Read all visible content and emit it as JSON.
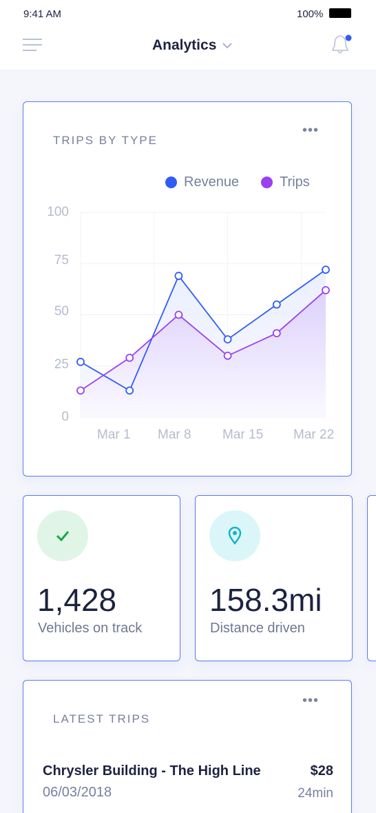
{
  "status": {
    "time": "9:41 AM",
    "battery": "100%"
  },
  "header": {
    "title": "Analytics",
    "menu_icon": "hamburger-icon",
    "bell_icon": "bell-icon",
    "accent": "#2f5cf5"
  },
  "chart_card": {
    "title": "TRIPS BY TYPE",
    "more": "•••"
  },
  "chart_data": {
    "type": "line",
    "title": "TRIPS BY TYPE",
    "x": [
      "",
      "Mar 1",
      "Mar 8",
      "Mar 15",
      "Mar 22",
      ""
    ],
    "xticks": [
      "Mar 1",
      "Mar 8",
      "Mar 15",
      "Mar 22"
    ],
    "yticks": [
      "100",
      "75",
      "50",
      "25",
      "0"
    ],
    "ylim": [
      0,
      100
    ],
    "grid": true,
    "legend": "top-right",
    "series": [
      {
        "name": "Revenue",
        "color": "#2f5cf5",
        "values": [
          27,
          13,
          69,
          38,
          55,
          72
        ]
      },
      {
        "name": "Trips",
        "color": "#9b40f0",
        "values": [
          13,
          29,
          50,
          30,
          41,
          62
        ]
      }
    ]
  },
  "stats": [
    {
      "value": "1,428",
      "label": "Vehicles on track",
      "icon": "check-icon",
      "icon_color": "#19a84a",
      "bg": "#e1f5e6"
    },
    {
      "value": "158.3mi",
      "label": "Distance driven",
      "icon": "map-pin-icon",
      "icon_color": "#12b3c9",
      "bg": "#daf6f8"
    }
  ],
  "latest": {
    "title": "LATEST TRIPS",
    "more": "•••",
    "trips": [
      {
        "name": "Chrysler Building - The High Line",
        "date": "06/03/2018",
        "price": "$28",
        "duration": "24min"
      }
    ]
  }
}
